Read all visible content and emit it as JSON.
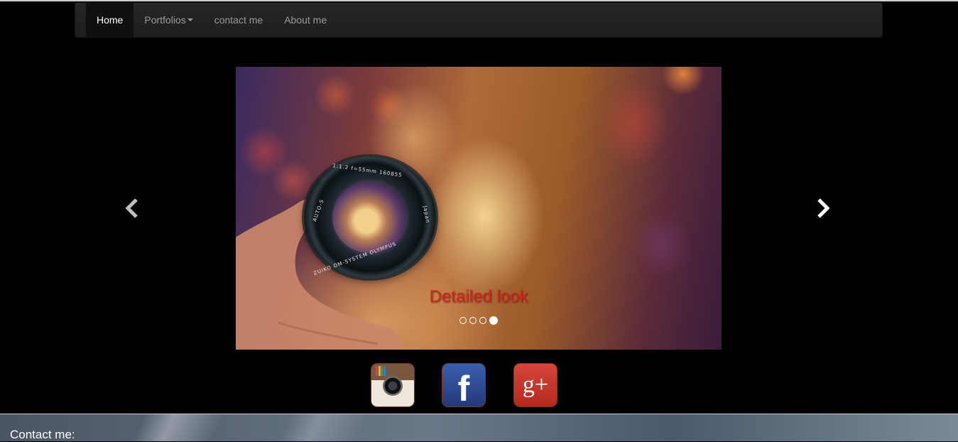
{
  "navbar": {
    "items": [
      {
        "label": "Home",
        "active": true
      },
      {
        "label": "Portfolios",
        "dropdown": true
      },
      {
        "label": "contact me"
      },
      {
        "label": "About me"
      }
    ]
  },
  "carousel": {
    "caption": "Detailed look",
    "caption_color": "#d8221a",
    "slide_count": 4,
    "active_index": 3,
    "prev_icon": "chevron-left-icon",
    "next_icon": "chevron-right-icon",
    "lens_text": {
      "top": "1:1.2  f=55mm  160855",
      "left": "AUTO-S",
      "bottom": "ZUIKO  OM-SYSTEM  OLYMPUS",
      "right": "Japan"
    }
  },
  "social": [
    {
      "name": "instagram",
      "icon": "instagram-icon"
    },
    {
      "name": "facebook",
      "icon": "facebook-icon",
      "glyph": "f"
    },
    {
      "name": "google-plus",
      "icon": "google-plus-icon",
      "glyph": "g+"
    }
  ],
  "footer": {
    "title": "Contact me:"
  }
}
